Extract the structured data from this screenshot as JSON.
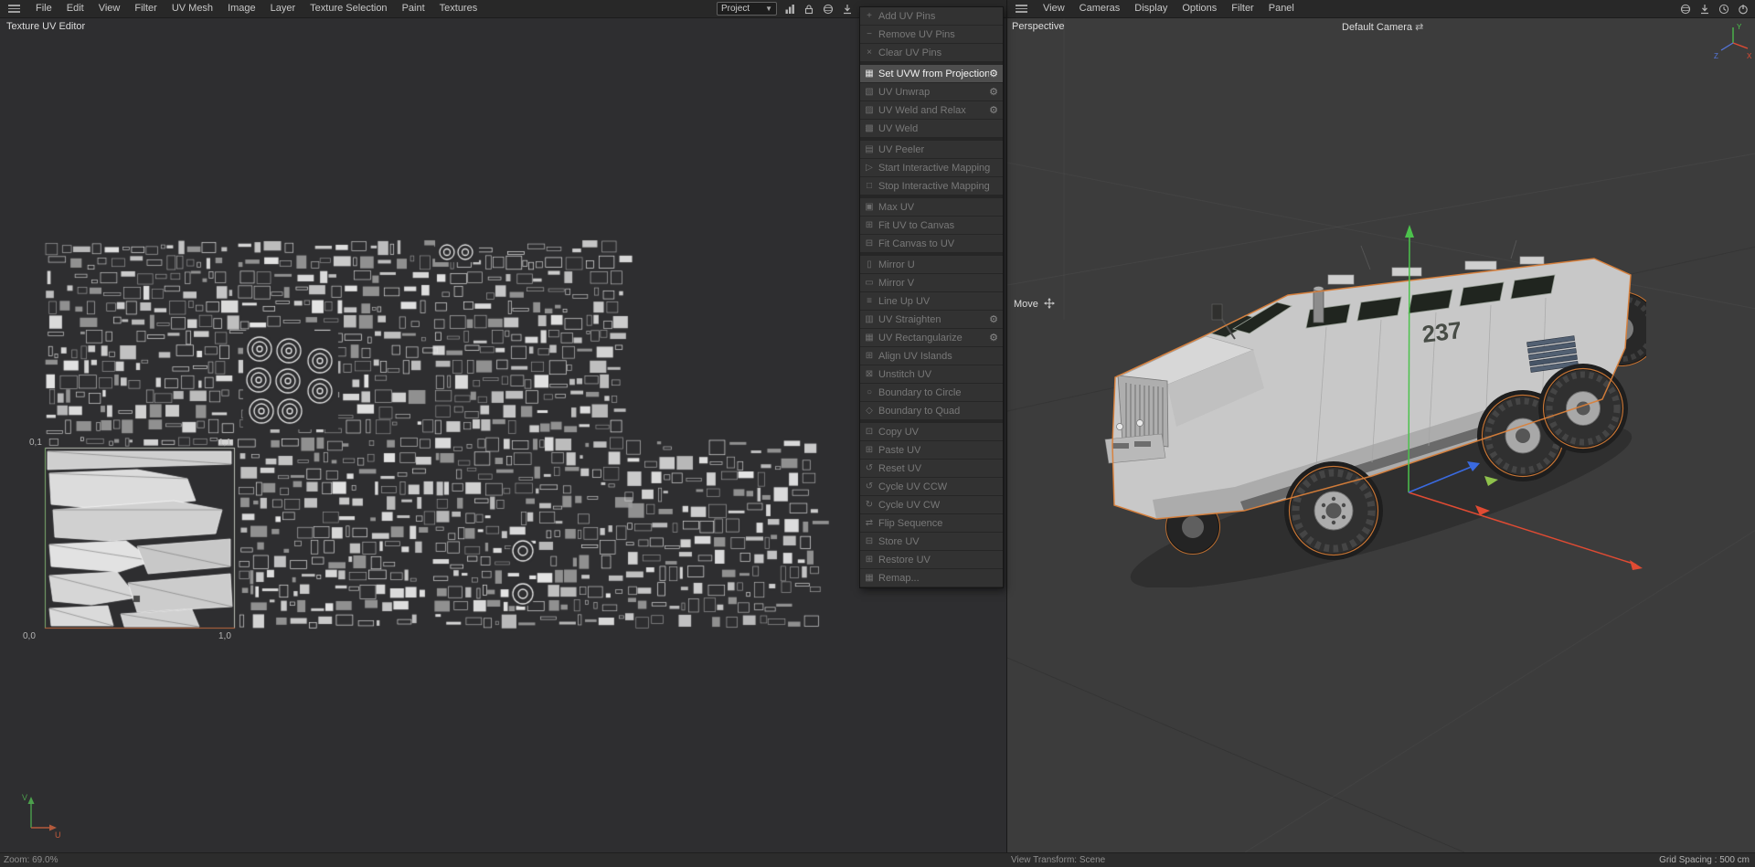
{
  "colors": {
    "accent_orange": "#d9803a",
    "axis_green": "#4cc24c",
    "axis_red": "#e04b33",
    "axis_blue": "#3a6ae0",
    "menu_highlight": "#4e4e4e"
  },
  "top_menubar": {
    "menus": [
      {
        "label": "File"
      },
      {
        "label": "Edit"
      },
      {
        "label": "View"
      },
      {
        "label": "Filter"
      },
      {
        "label": "UV Mesh"
      },
      {
        "label": "Image"
      },
      {
        "label": "Layer"
      },
      {
        "label": "Texture Selection"
      },
      {
        "label": "Paint"
      },
      {
        "label": "Textures"
      }
    ],
    "project_dropdown": {
      "value": "Project"
    },
    "icons": [
      {
        "name": "histogram-icon"
      },
      {
        "name": "lock-icon"
      },
      {
        "name": "sphere-icon"
      },
      {
        "name": "download-arrow-icon"
      }
    ]
  },
  "uv_editor": {
    "title": "Texture UV Editor",
    "grid_labels": {
      "top_left": "0,1",
      "top_right": "1,1",
      "bottom_left": "0,0",
      "bottom_right": "1,0"
    },
    "axes": {
      "u": "U",
      "v": "V"
    },
    "status": {
      "zoom": "Zoom: 69.0%"
    }
  },
  "uv_menu": {
    "items": [
      {
        "label": "Add UV Pins",
        "icon": "add-pin-icon",
        "enabled": false
      },
      {
        "label": "Remove UV Pins",
        "icon": "remove-pin-icon",
        "enabled": false
      },
      {
        "label": "Clear UV Pins",
        "icon": "clear-pins-icon",
        "enabled": false,
        "separator_after": true
      },
      {
        "label": "Set UVW from Projection",
        "icon": "projection-icon",
        "enabled": true,
        "highlighted": true,
        "gear": true
      },
      {
        "label": "UV Unwrap",
        "icon": "unwrap-icon",
        "enabled": false,
        "gear": true
      },
      {
        "label": "UV Weld and Relax",
        "icon": "weld-relax-icon",
        "enabled": false,
        "gear": true
      },
      {
        "label": "UV Weld",
        "icon": "weld-icon",
        "enabled": false,
        "separator_after": true
      },
      {
        "label": "UV Peeler",
        "icon": "peeler-icon",
        "enabled": false
      },
      {
        "label": "Start Interactive Mapping",
        "icon": "start-mapping-icon",
        "enabled": false
      },
      {
        "label": "Stop Interactive Mapping",
        "icon": "stop-mapping-icon",
        "enabled": false,
        "separator_after": true
      },
      {
        "label": "Max UV",
        "icon": "max-uv-icon",
        "enabled": false
      },
      {
        "label": "Fit UV to Canvas",
        "icon": "fit-uv-canvas-icon",
        "enabled": false
      },
      {
        "label": "Fit Canvas to UV",
        "icon": "fit-canvas-uv-icon",
        "enabled": false,
        "separator_after": true
      },
      {
        "label": "Mirror U",
        "icon": "mirror-u-icon",
        "enabled": false
      },
      {
        "label": "Mirror V",
        "icon": "mirror-v-icon",
        "enabled": false
      },
      {
        "label": "Line Up UV",
        "icon": "line-up-icon",
        "enabled": false
      },
      {
        "label": "UV Straighten",
        "icon": "straighten-icon",
        "enabled": false,
        "gear": true
      },
      {
        "label": "UV Rectangularize",
        "icon": "rectangularize-icon",
        "enabled": false,
        "gear": true
      },
      {
        "label": "Align UV Islands",
        "icon": "align-islands-icon",
        "enabled": false
      },
      {
        "label": "Unstitch UV",
        "icon": "unstitch-icon",
        "enabled": false
      },
      {
        "label": "Boundary to Circle",
        "icon": "boundary-circle-icon",
        "enabled": false
      },
      {
        "label": "Boundary to Quad",
        "icon": "boundary-quad-icon",
        "enabled": false,
        "separator_after": true
      },
      {
        "label": "Copy UV",
        "icon": "copy-icon",
        "enabled": false
      },
      {
        "label": "Paste UV",
        "icon": "paste-icon",
        "enabled": false
      },
      {
        "label": "Reset UV",
        "icon": "reset-icon",
        "enabled": false
      },
      {
        "label": "Cycle UV CCW",
        "icon": "cycle-ccw-icon",
        "enabled": false
      },
      {
        "label": "Cycle UV CW",
        "icon": "cycle-cw-icon",
        "enabled": false
      },
      {
        "label": "Flip Sequence",
        "icon": "flip-sequence-icon",
        "enabled": false
      },
      {
        "label": "Store UV",
        "icon": "store-icon",
        "enabled": false
      },
      {
        "label": "Restore UV",
        "icon": "restore-icon",
        "enabled": false
      },
      {
        "label": "Remap...",
        "icon": "remap-icon",
        "enabled": false
      }
    ]
  },
  "viewport": {
    "menubar": [
      {
        "label": "View"
      },
      {
        "label": "Cameras"
      },
      {
        "label": "Display"
      },
      {
        "label": "Options"
      },
      {
        "label": "Filter"
      },
      {
        "label": "Panel"
      }
    ],
    "menubar_icons": [
      {
        "name": "sphere-icon"
      },
      {
        "name": "download-arrow-icon"
      },
      {
        "name": "history-icon"
      },
      {
        "name": "power-icon"
      }
    ],
    "view_label": "Perspective",
    "camera_label": "Default Camera",
    "tool_label": "Move",
    "vehicle_number": "237",
    "axis_labels": {
      "x": "X",
      "y": "Y",
      "z": "Z"
    },
    "status": {
      "left": "View Transform: Scene",
      "right": "Grid Spacing : 500 cm"
    }
  }
}
